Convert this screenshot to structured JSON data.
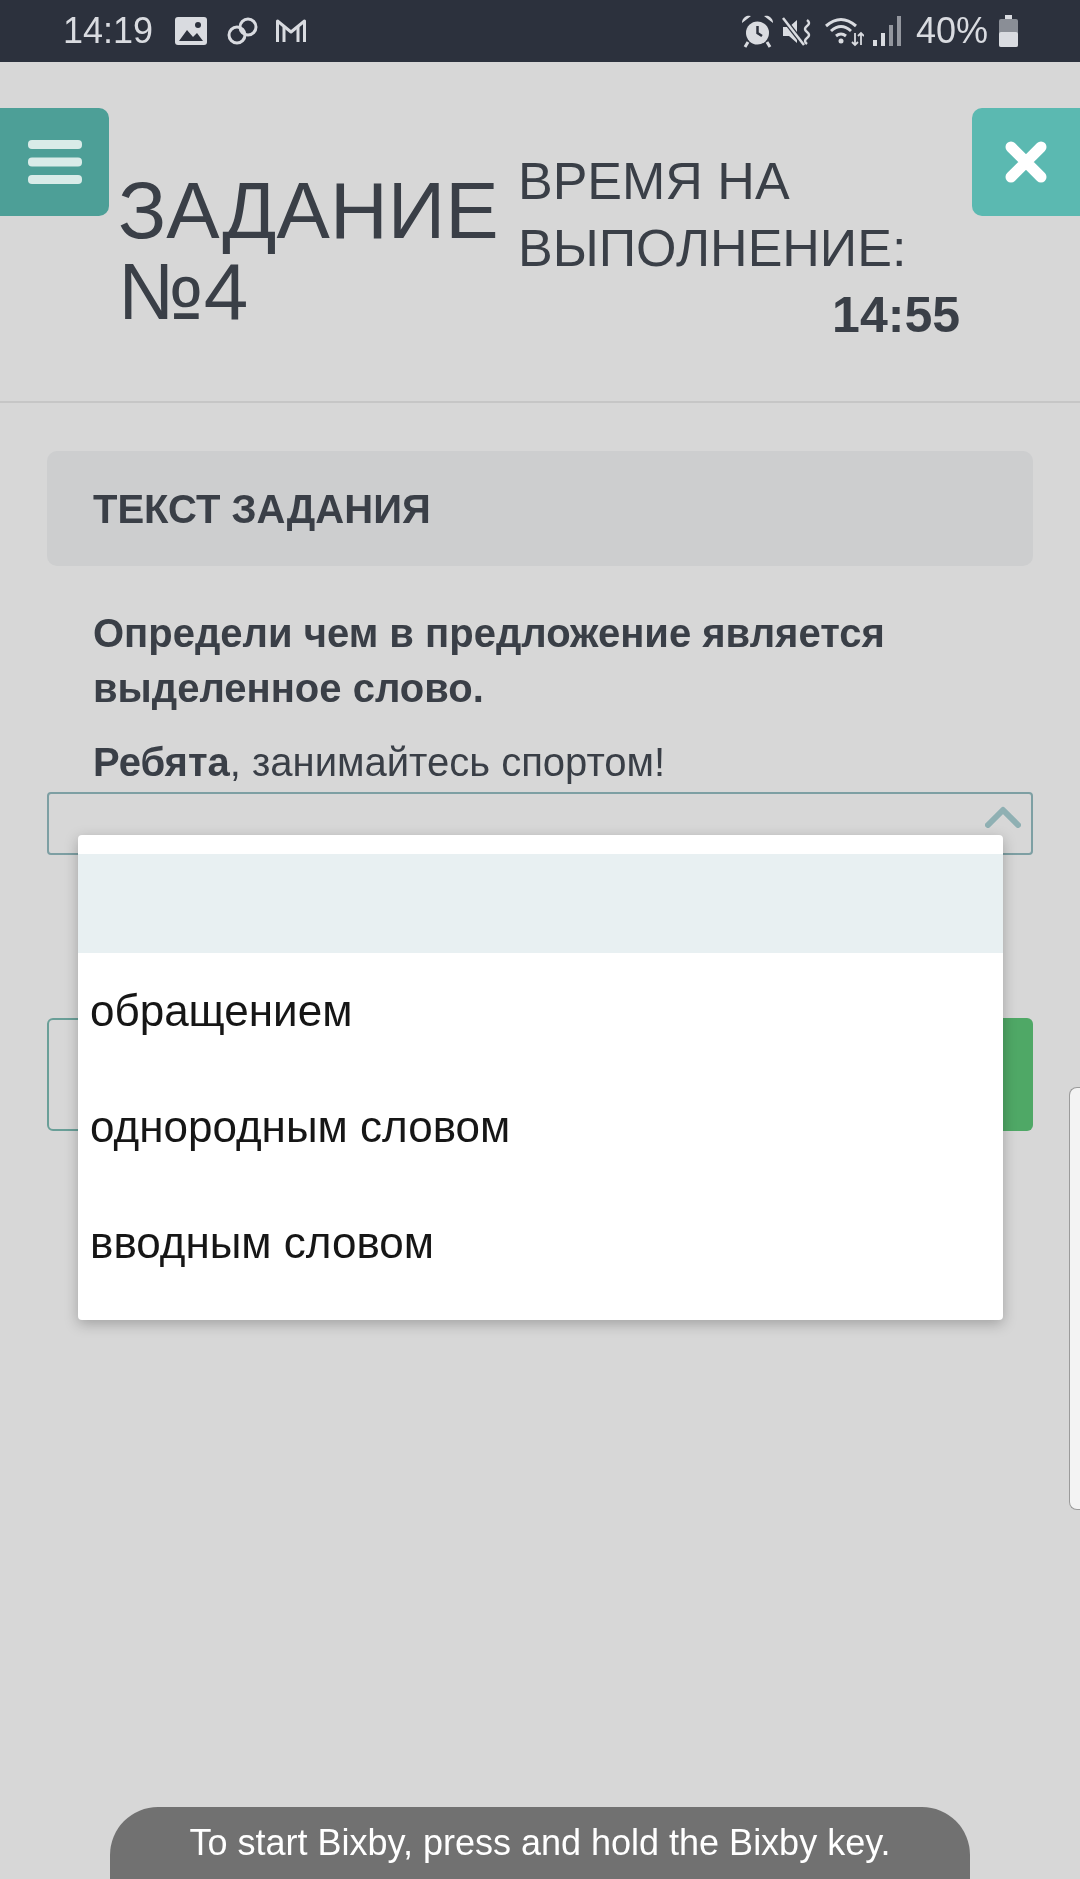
{
  "status_bar": {
    "time": "14:19",
    "battery": "40%"
  },
  "header": {
    "title": "ЗАДАНИЕ №4",
    "timer_label": "ВРЕМЯ НА ВЫПОЛНЕНИЕ:",
    "timer_value": "14:55"
  },
  "task": {
    "heading": "ТЕКСТ ЗАДАНИЯ",
    "question": "Определи чем в предложение является выделенное слово.",
    "sentence": "**Ребята**, занимайтесь спортом!"
  },
  "answer_select": {
    "expanded": true,
    "options": [
      {
        "selected": true
      },
      {
        "label": "обращением",
        "selected": false
      },
      {
        "label": "однородным словом",
        "selected": false
      },
      {
        "label": "вводным словом",
        "selected": false
      }
    ]
  },
  "toast": {
    "text": "To start Bixby, press and hold the Bixby key."
  }
}
